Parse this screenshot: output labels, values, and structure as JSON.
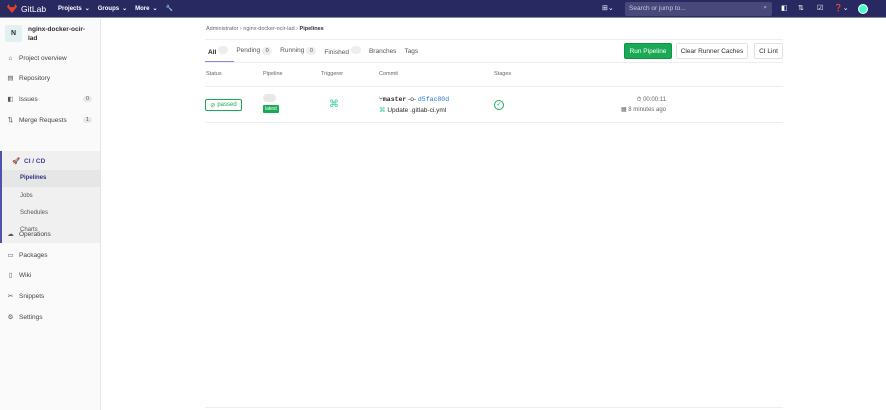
{
  "nav": {
    "brand": "GitLab",
    "projects": "Projects",
    "groups": "Groups",
    "more": "More",
    "search_placeholder": "Search or jump to..."
  },
  "sidebar": {
    "avatar_letter": "N",
    "project_name": "nginx-docker-ocir-lad",
    "items": [
      {
        "label": "Project overview"
      },
      {
        "label": "Repository"
      },
      {
        "label": "Issues",
        "badge": "0"
      },
      {
        "label": "Merge Requests",
        "badge": "1"
      },
      {
        "label": "CI / CD"
      },
      {
        "label": "Operations"
      },
      {
        "label": "Packages"
      },
      {
        "label": "Wiki"
      },
      {
        "label": "Snippets"
      },
      {
        "label": "Settings"
      }
    ],
    "cicd_sub": [
      "Pipelines",
      "Jobs",
      "Schedules",
      "Charts"
    ]
  },
  "breadcrumb": [
    "Administrator",
    "nginx-docker-ocir-lad",
    "Pipelines"
  ],
  "tabs": [
    {
      "label": "All"
    },
    {
      "label": "Pending",
      "count": "0"
    },
    {
      "label": "Running",
      "count": "0"
    },
    {
      "label": "Finished"
    },
    {
      "label": "Branches"
    },
    {
      "label": "Tags"
    }
  ],
  "buttons": {
    "run": "Run Pipeline",
    "clear": "Clear Runner Caches",
    "lint": "CI Lint"
  },
  "table": {
    "headers": [
      "Status",
      "Pipeline",
      "Triggerer",
      "Commit",
      "Stages"
    ],
    "rows": [
      {
        "status": "passed",
        "tag": "latest",
        "branch": "master",
        "sha": "d5fac80d",
        "message": "Update .gitlab-ci.yml",
        "duration": "00:00:11",
        "finished": "8 minutes ago"
      }
    ]
  },
  "colors": {
    "nav": "#292961",
    "success": "#1aaa55",
    "link": "#1f78d1"
  }
}
